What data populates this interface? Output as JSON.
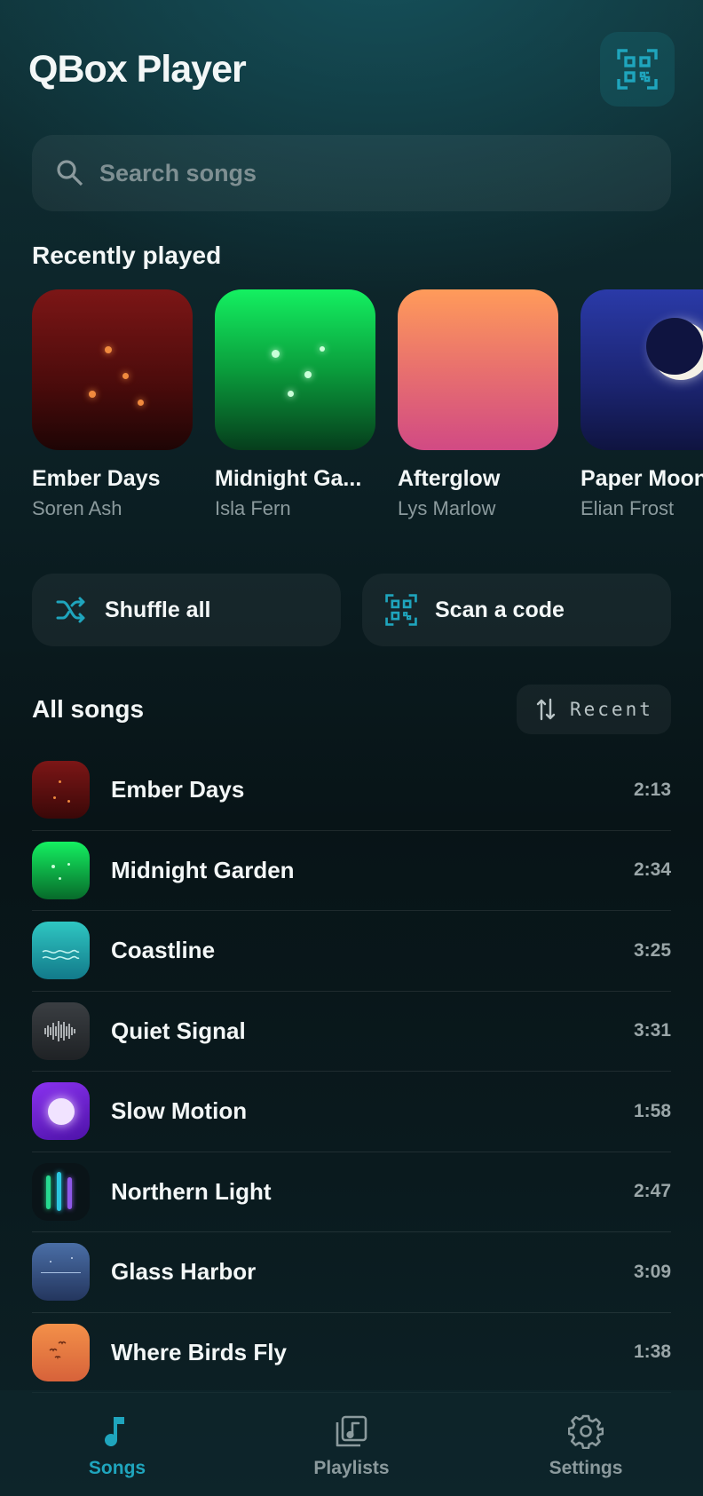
{
  "app": {
    "title": "QBox Player"
  },
  "header": {
    "scan_icon": "qr-scan-icon"
  },
  "search": {
    "placeholder": "Search songs",
    "icon": "search-icon"
  },
  "recent": {
    "title": "Recently played",
    "items": [
      {
        "title": "Ember Days",
        "artist": "Soren Ash"
      },
      {
        "title": "Midnight Ga...",
        "artist": "Isla Fern"
      },
      {
        "title": "Afterglow",
        "artist": "Lys Marlow"
      },
      {
        "title": "Paper Moon",
        "artist": "Elian Frost"
      }
    ]
  },
  "actions": {
    "shuffle": "Shuffle all",
    "scan": "Scan a code"
  },
  "songs": {
    "title": "All songs",
    "sort_label": "Recent",
    "items": [
      {
        "title": "Ember Days",
        "duration": "2:13"
      },
      {
        "title": "Midnight Garden",
        "duration": "2:34"
      },
      {
        "title": "Coastline",
        "duration": "3:25"
      },
      {
        "title": "Quiet Signal",
        "duration": "3:31"
      },
      {
        "title": "Slow Motion",
        "duration": "1:58"
      },
      {
        "title": "Northern Light",
        "duration": "2:47"
      },
      {
        "title": "Glass Harbor",
        "duration": "3:09"
      },
      {
        "title": "Where Birds Fly",
        "duration": "1:38"
      }
    ]
  },
  "nav": {
    "songs": "Songs",
    "playlists": "Playlists",
    "settings": "Settings",
    "active": "songs"
  },
  "colors": {
    "accent": "#1fa5bd",
    "background": "#0a1a1e",
    "text": "#f3f7f7",
    "muted": "#8b9a9d"
  }
}
